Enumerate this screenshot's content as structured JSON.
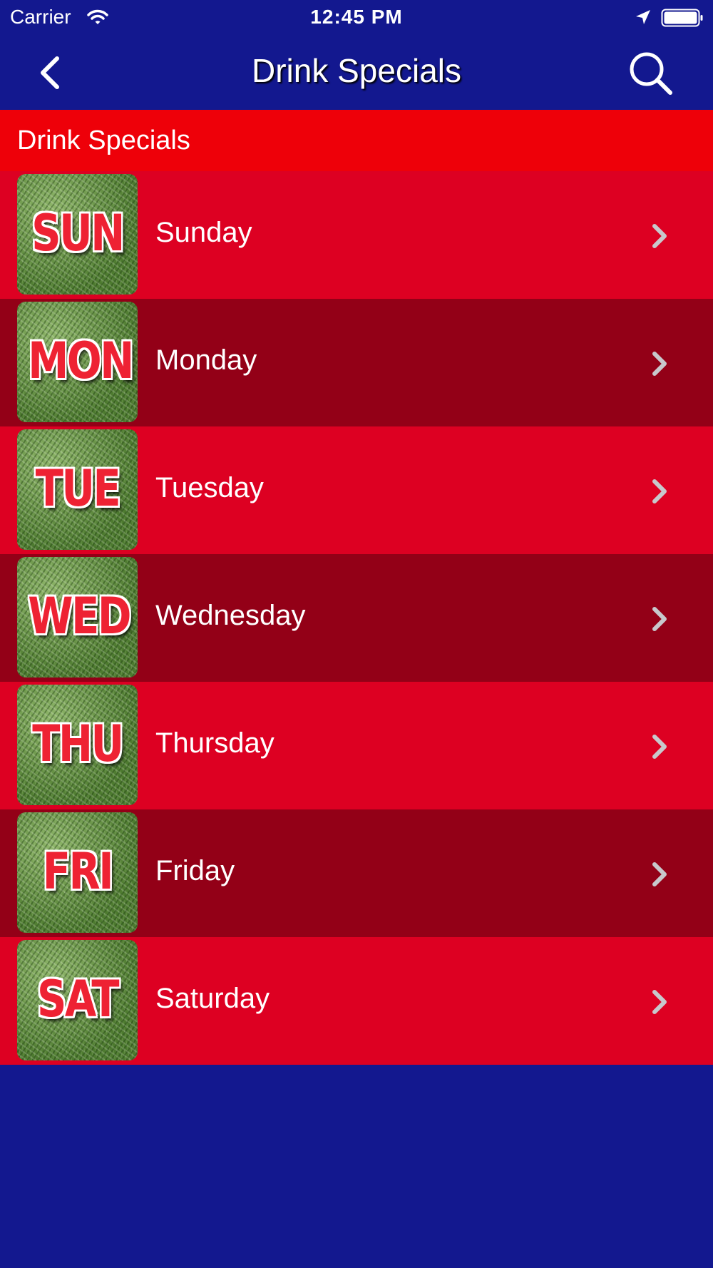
{
  "status_bar": {
    "carrier": "Carrier",
    "time": "12:45 PM"
  },
  "nav": {
    "title": "Drink Specials"
  },
  "section": {
    "title": "Drink Specials"
  },
  "days": [
    {
      "abbr": "SUN",
      "label": "Sunday"
    },
    {
      "abbr": "MON",
      "label": "Monday"
    },
    {
      "abbr": "TUE",
      "label": "Tuesday"
    },
    {
      "abbr": "WED",
      "label": "Wednesday"
    },
    {
      "abbr": "THU",
      "label": "Thursday"
    },
    {
      "abbr": "FRI",
      "label": "Friday"
    },
    {
      "abbr": "SAT",
      "label": "Saturday"
    }
  ],
  "icons": {
    "back": "chevron-left-icon",
    "search": "search-icon",
    "row": "chevron-right-icon"
  },
  "colors": {
    "nav_background": "#13188f",
    "section_header": "#ee0009",
    "row_light": "#dd0022",
    "row_dark": "#930017",
    "thumb_text": "#ee2233"
  }
}
